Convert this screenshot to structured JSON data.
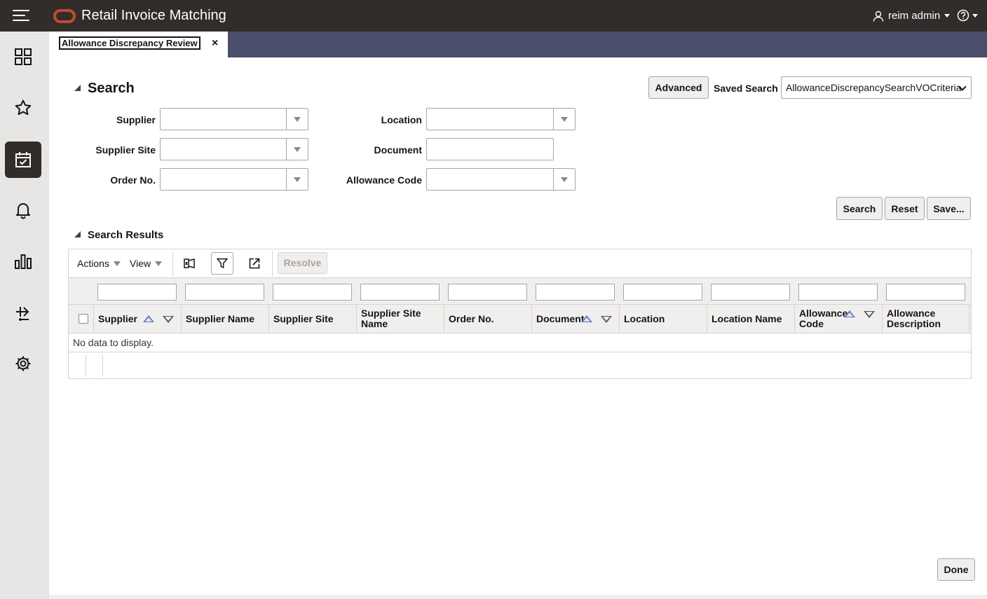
{
  "app": {
    "title": "Retail Invoice Matching",
    "user": "reim admin",
    "accent_color": "#c74634",
    "header_bg": "#312d2a"
  },
  "nav": {
    "items": [
      {
        "icon": "dashboard-grid-icon",
        "active": false
      },
      {
        "icon": "favorites-star-icon",
        "active": false
      },
      {
        "icon": "tasks-calendar-check-icon",
        "active": true
      },
      {
        "icon": "notifications-bell-icon",
        "active": false
      },
      {
        "icon": "reports-bar-chart-icon",
        "active": false
      },
      {
        "icon": "transfer-arrows-icon",
        "active": false
      },
      {
        "icon": "settings-gear-icon",
        "active": false
      }
    ]
  },
  "tabs": [
    {
      "label": "Allowance Discrepancy Review",
      "close": "×"
    }
  ],
  "search": {
    "title": "Search",
    "advanced_label": "Advanced",
    "saved_search_label": "Saved Search",
    "saved_search_value": "AllowanceDiscrepancySearchVOCriteria",
    "fields": {
      "supplier": "Supplier",
      "supplier_site": "Supplier Site",
      "order_no": "Order No.",
      "location": "Location",
      "document": "Document",
      "allowance_code": "Allowance Code"
    },
    "buttons": {
      "search": "Search",
      "reset": "Reset",
      "save": "Save..."
    }
  },
  "results": {
    "title": "Search Results",
    "toolbar": {
      "actions": "Actions",
      "view": "View",
      "resolve": "Resolve"
    },
    "columns": [
      "Supplier",
      "Supplier Name",
      "Supplier Site",
      "Supplier Site Name",
      "Order No.",
      "Document",
      "Location",
      "Location Name",
      "Allowance Code",
      "Allowance Description"
    ],
    "empty_text": "No data to display."
  },
  "footer": {
    "done_label": "Done"
  }
}
